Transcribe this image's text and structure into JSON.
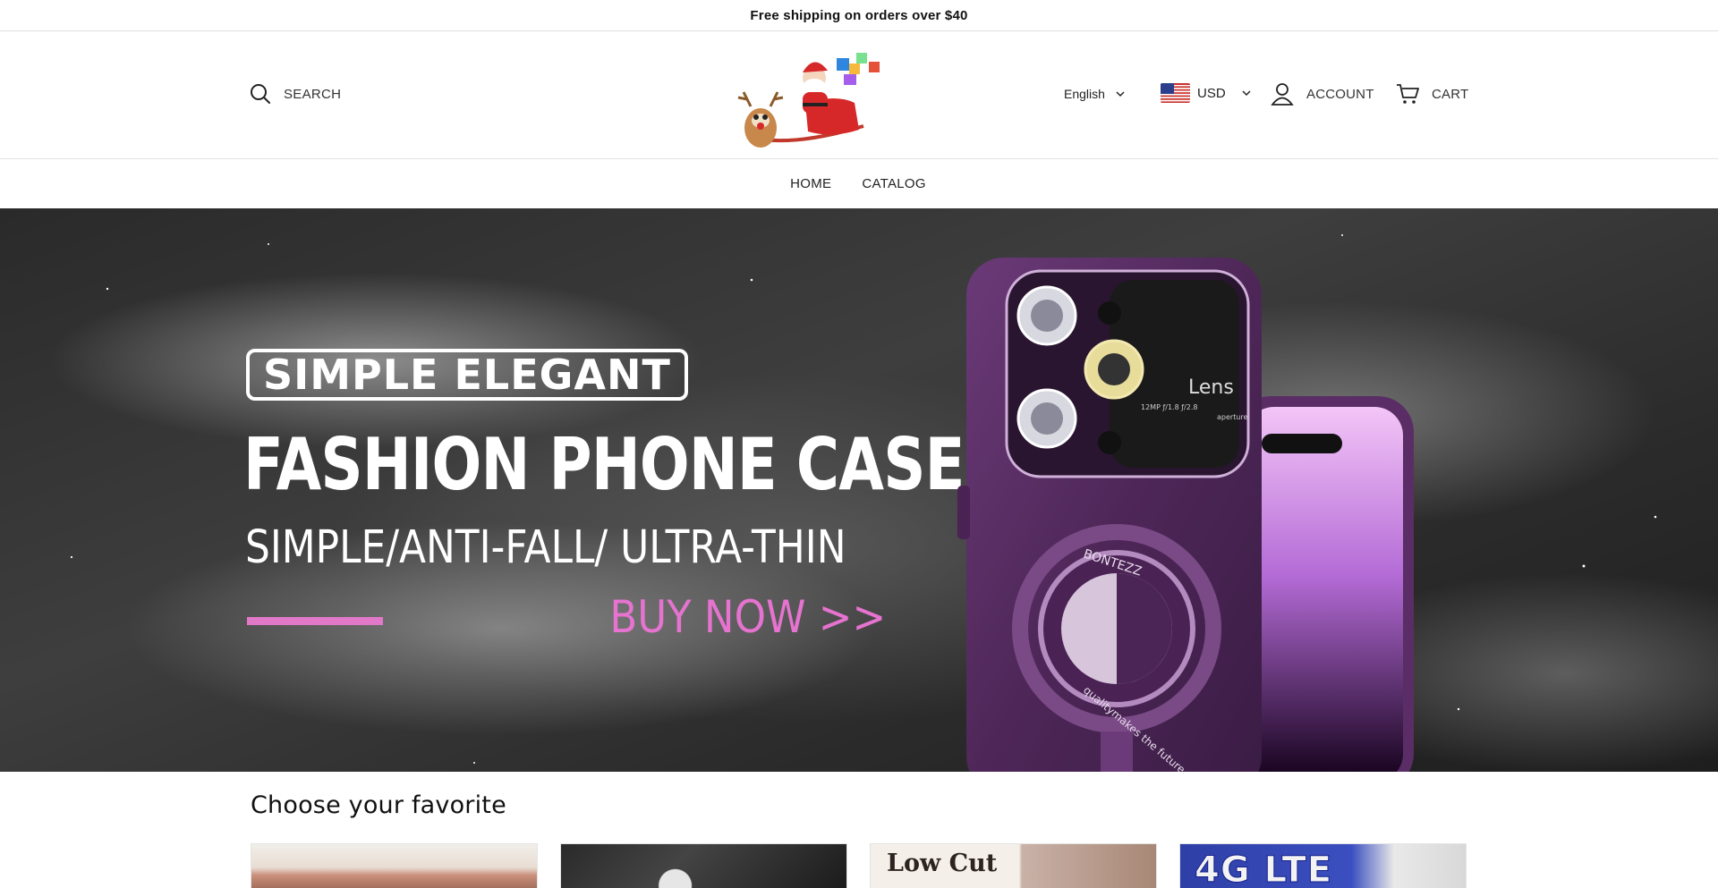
{
  "announcement": {
    "text": "Free shipping on orders over $40"
  },
  "header": {
    "search_label": "SEARCH",
    "language": {
      "selected": "English"
    },
    "currency": {
      "selected": "USD",
      "flag": "us-flag"
    },
    "account_label": "ACCOUNT",
    "cart_label": "CART",
    "logo": "santa-sleigh-logo"
  },
  "nav": {
    "items": [
      {
        "label": "HOME"
      },
      {
        "label": "CATALOG"
      }
    ]
  },
  "hero": {
    "badge": "SIMPLE ELEGANT",
    "headline": "FASHION PHONE CASE",
    "subline": "SIMPLE/ANTI-FALL/ ULTRA-THIN",
    "cta": "BUY NOW >>",
    "phone_brand": "BONTEZZ",
    "phone_tagline": "qualitymakes the future",
    "lens_label": "Lens",
    "lens_spec": "12MP ƒ/1.8 ƒ/2.8",
    "aperture_label": "aperture",
    "colors": {
      "accent_pink": "#e573cf",
      "phone_purple": "#5a2d66"
    }
  },
  "collections": {
    "title": "Choose your favorite",
    "cards": [
      {
        "name": "collection-card-1"
      },
      {
        "name": "collection-card-2"
      },
      {
        "name": "collection-card-3",
        "text": "Low Cut"
      },
      {
        "name": "collection-card-4",
        "text": "4G LTE"
      }
    ]
  }
}
